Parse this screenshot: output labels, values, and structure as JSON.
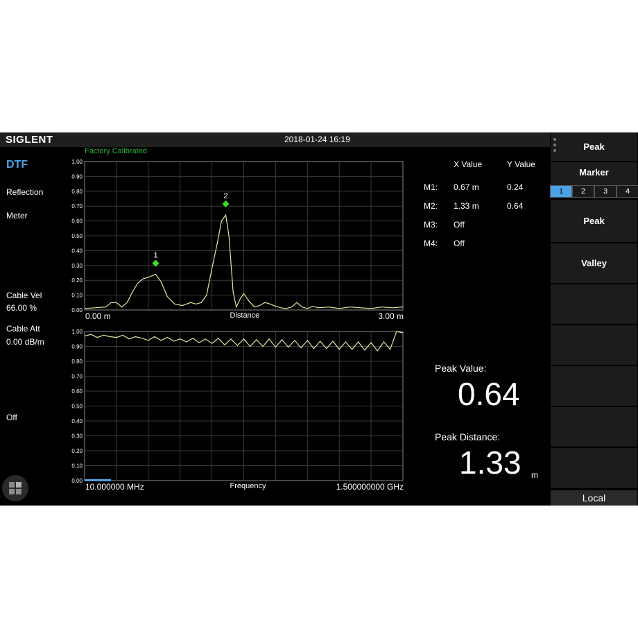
{
  "header": {
    "logo": "SIGLENT",
    "datetime": "2018-01-24 16:19",
    "calibration_status": "Factory Calibrated"
  },
  "left_panel": {
    "mode": "DTF",
    "reflection_label": "Reflection",
    "meter_label": "Meter",
    "cable_vel_label": "Cable Vel",
    "cable_vel_value": "66.00 %",
    "cable_att_label": "Cable Att",
    "cable_att_value": "0.00 dB/m",
    "off_label": "Off"
  },
  "marker_table": {
    "headers": [
      "X Value",
      "Y Value"
    ],
    "rows": [
      {
        "name": "M1:",
        "x": "0.67 m",
        "y": "0.24"
      },
      {
        "name": "M2:",
        "x": "1.33 m",
        "y": "0.64"
      },
      {
        "name": "M3:",
        "x": "Off",
        "y": ""
      },
      {
        "name": "M4:",
        "x": "Off",
        "y": ""
      }
    ]
  },
  "peak": {
    "value_label": "Peak Value:",
    "value": "0.64",
    "distance_label": "Peak Distance:",
    "distance": "1.33",
    "distance_unit": "m"
  },
  "softkeys": {
    "peak_top": "Peak",
    "marker": "Marker",
    "marker_tabs": [
      "1",
      "2",
      "3",
      "4"
    ],
    "active_tab": 0,
    "peak": "Peak",
    "valley": "Valley",
    "local": "Local"
  },
  "colors": {
    "trace": "#e8e6a0",
    "marker": "#3bdc2a",
    "grid": "#3a3a3a",
    "accent": "#4aa3e6"
  },
  "chart_data": [
    {
      "type": "line",
      "name": "distance-plot",
      "xlabel": "Distance",
      "x_start_label": "0.00 m",
      "x_end_label": "3.00 m",
      "xlim": [
        0,
        3
      ],
      "ylim": [
        0,
        1
      ],
      "yticks": [
        "1.00",
        "0.90",
        "0.80",
        "0.70",
        "0.60",
        "0.50",
        "0.40",
        "0.30",
        "0.20",
        "0.10",
        "0.00"
      ],
      "x": [
        0,
        0.1,
        0.2,
        0.25,
        0.3,
        0.35,
        0.4,
        0.45,
        0.5,
        0.55,
        0.6,
        0.67,
        0.72,
        0.78,
        0.85,
        0.92,
        1.0,
        1.05,
        1.1,
        1.15,
        1.2,
        1.25,
        1.29,
        1.33,
        1.36,
        1.4,
        1.43,
        1.47,
        1.5,
        1.55,
        1.6,
        1.65,
        1.7,
        1.75,
        1.8,
        1.85,
        1.9,
        1.95,
        2.0,
        2.05,
        2.1,
        2.15,
        2.2,
        2.3,
        2.4,
        2.5,
        2.6,
        2.7,
        2.8,
        2.9,
        3.0
      ],
      "y": [
        0.01,
        0.015,
        0.02,
        0.05,
        0.05,
        0.02,
        0.05,
        0.12,
        0.18,
        0.21,
        0.22,
        0.24,
        0.19,
        0.09,
        0.04,
        0.03,
        0.05,
        0.04,
        0.05,
        0.1,
        0.28,
        0.45,
        0.6,
        0.64,
        0.5,
        0.12,
        0.02,
        0.08,
        0.11,
        0.06,
        0.02,
        0.03,
        0.05,
        0.04,
        0.025,
        0.015,
        0.01,
        0.02,
        0.05,
        0.02,
        0.01,
        0.025,
        0.015,
        0.02,
        0.01,
        0.02,
        0.015,
        0.01,
        0.02,
        0.015,
        0.02
      ],
      "markers": [
        {
          "label": "1",
          "x": 0.67,
          "y": 0.24
        },
        {
          "label": "2",
          "x": 1.33,
          "y": 0.64
        }
      ]
    },
    {
      "type": "line",
      "name": "frequency-plot",
      "xlabel": "Frequency",
      "x_start_label": "10.000000 MHz",
      "x_end_label": "1.500000000 GHz",
      "xlim": [
        0,
        1
      ],
      "ylim": [
        0,
        1
      ],
      "yticks": [
        "1.00",
        "0.90",
        "0.80",
        "0.70",
        "0.60",
        "0.50",
        "0.40",
        "0.30",
        "0.20",
        "0.10",
        "0.00"
      ],
      "x": [
        0,
        0.02,
        0.04,
        0.06,
        0.08,
        0.1,
        0.12,
        0.14,
        0.16,
        0.18,
        0.2,
        0.22,
        0.24,
        0.26,
        0.28,
        0.3,
        0.32,
        0.34,
        0.36,
        0.38,
        0.4,
        0.42,
        0.44,
        0.46,
        0.48,
        0.5,
        0.52,
        0.54,
        0.56,
        0.58,
        0.6,
        0.62,
        0.64,
        0.66,
        0.68,
        0.7,
        0.72,
        0.74,
        0.76,
        0.78,
        0.8,
        0.82,
        0.84,
        0.86,
        0.88,
        0.9,
        0.92,
        0.94,
        0.96,
        0.98,
        1.0
      ],
      "y": [
        0.97,
        0.98,
        0.96,
        0.975,
        0.965,
        0.96,
        0.975,
        0.95,
        0.965,
        0.955,
        0.94,
        0.965,
        0.94,
        0.96,
        0.935,
        0.95,
        0.93,
        0.955,
        0.925,
        0.95,
        0.92,
        0.955,
        0.91,
        0.95,
        0.905,
        0.95,
        0.9,
        0.945,
        0.9,
        0.95,
        0.895,
        0.945,
        0.895,
        0.94,
        0.89,
        0.94,
        0.885,
        0.935,
        0.885,
        0.935,
        0.88,
        0.93,
        0.88,
        0.93,
        0.875,
        0.925,
        0.87,
        0.93,
        0.88,
        1.0,
        0.99
      ]
    }
  ]
}
